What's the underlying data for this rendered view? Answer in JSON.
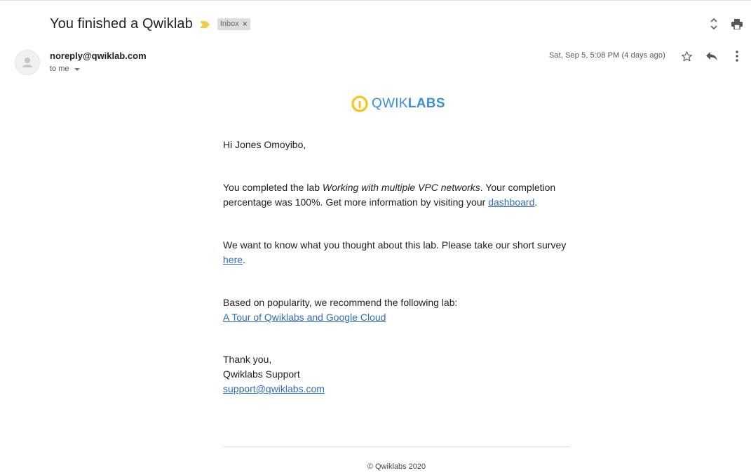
{
  "email": {
    "subject": "You finished a Qwiklab",
    "label": "Inbox",
    "label_remove": "×",
    "sender": "noreply@qwiklab.com",
    "recipient": "to me",
    "date": "Sat, Sep 5, 5:08 PM (4 days ago)"
  },
  "icons": {
    "importance": "importance-marker-icon",
    "expand": "expand-collapse-icon",
    "print": "print-icon",
    "avatar": "person-icon",
    "star": "star-icon",
    "reply": "reply-icon",
    "more": "more-vert-icon"
  },
  "colors": {
    "link": "#2f6dbd",
    "logo_blue": "#3b8fe0",
    "logo_yellow": "#f5c518",
    "importance": "#f2c94c"
  },
  "body": {
    "logo_prefix": "QWIK",
    "logo_suffix": "LABS",
    "greeting": "Hi Jones Omoyibo,",
    "p1_before": "You completed the lab ",
    "p1_lab": "Working with multiple VPC networks",
    "p1_after": ". Your completion percentage was 100%. Get more information by visiting your ",
    "p1_link": "dashboard",
    "p1_end": ".",
    "p2_before": "We want to know what you thought about this lab. Please take our short survey ",
    "p2_link": "here",
    "p2_end": ".",
    "p3_text": "Based on popularity, we recommend the following lab:",
    "p3_link": "A Tour of Qwiklabs and Google Cloud",
    "signoff": "Thank you,",
    "signature": "Qwiklabs Support",
    "support_email": "support@qwiklabs.com"
  },
  "footer": {
    "copyright": "© Qwiklabs 2020"
  }
}
